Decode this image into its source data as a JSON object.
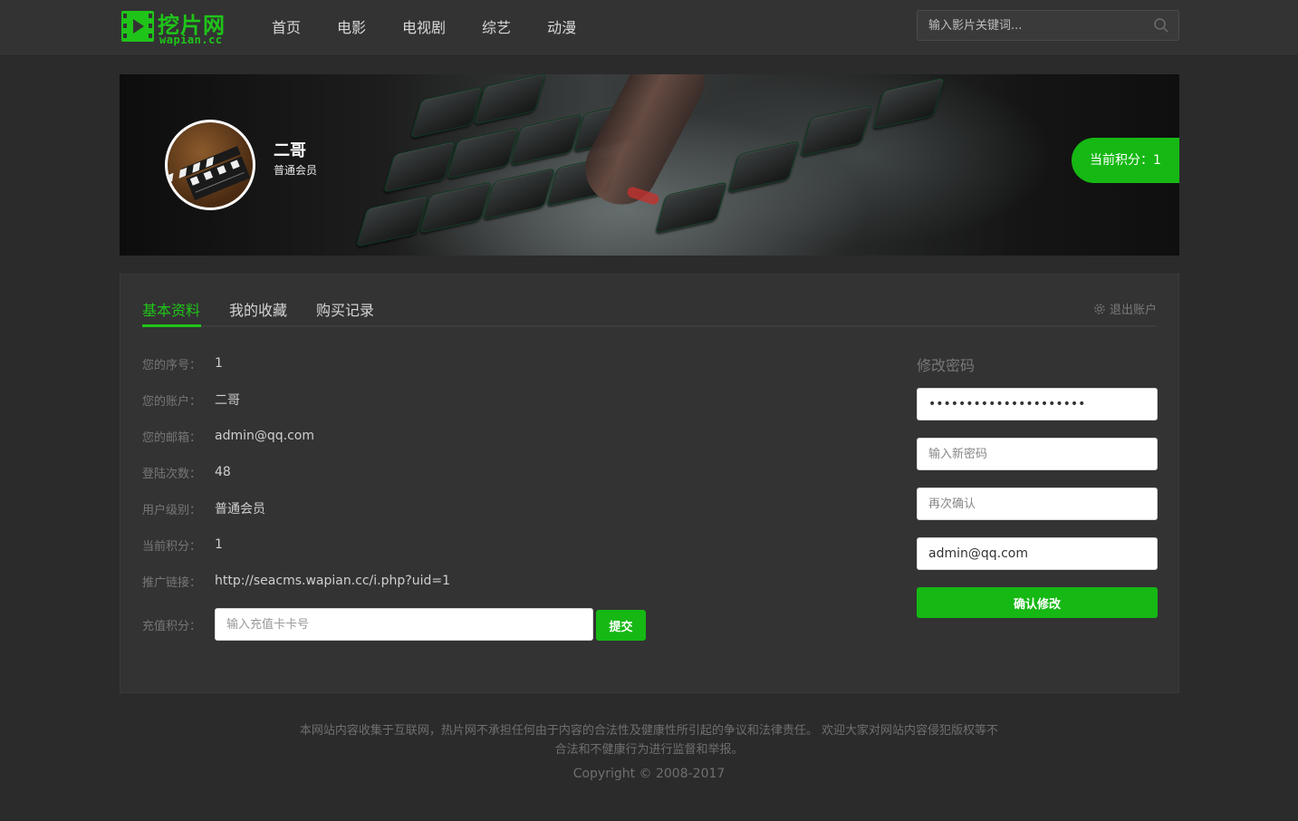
{
  "header": {
    "logo_text": "挖片网",
    "logo_sub": "wapian.cc",
    "nav": [
      "首页",
      "电影",
      "电视剧",
      "综艺",
      "动漫"
    ],
    "search_placeholder": "输入影片关键词..."
  },
  "banner": {
    "user_name": "二哥",
    "user_level": "普通会员",
    "points_badge": "当前积分：1"
  },
  "tabs": {
    "items": [
      "基本资料",
      "我的收藏",
      "购买记录"
    ],
    "active": 0,
    "logout": "退出账户"
  },
  "profile": {
    "rows": [
      {
        "label": "您的序号：",
        "value": "1"
      },
      {
        "label": "您的账户：",
        "value": "二哥"
      },
      {
        "label": "您的邮箱：",
        "value": "admin@qq.com"
      },
      {
        "label": "登陆次数：",
        "value": "48"
      },
      {
        "label": "用户级别：",
        "value": "普通会员"
      },
      {
        "label": "当前积分：",
        "value": "1"
      },
      {
        "label": "推广链接：",
        "value": "http://seacms.wapian.cc/i.php?uid=1"
      }
    ],
    "recharge_label": "充值积分：",
    "recharge_placeholder": "输入充值卡卡号",
    "submit_label": "提交"
  },
  "password": {
    "title": "修改密码",
    "current_value": "•••••••••••••••••••••",
    "new_placeholder": "输入新密码",
    "confirm_placeholder": "再次确认",
    "email_value": "admin@qq.com",
    "confirm_button": "确认修改"
  },
  "footer": {
    "disclaimer": "本网站内容收集于互联网，热片网不承担任何由于内容的合法性及健康性所引起的争议和法律责任。 欢迎大家对网站内容侵犯版权等不合法和不健康行为进行监督和举报。",
    "copyright": "Copyright © 2008-2017"
  },
  "colors": {
    "accent": "#16b814",
    "background": "#2b2b2b",
    "panel": "#333333"
  }
}
